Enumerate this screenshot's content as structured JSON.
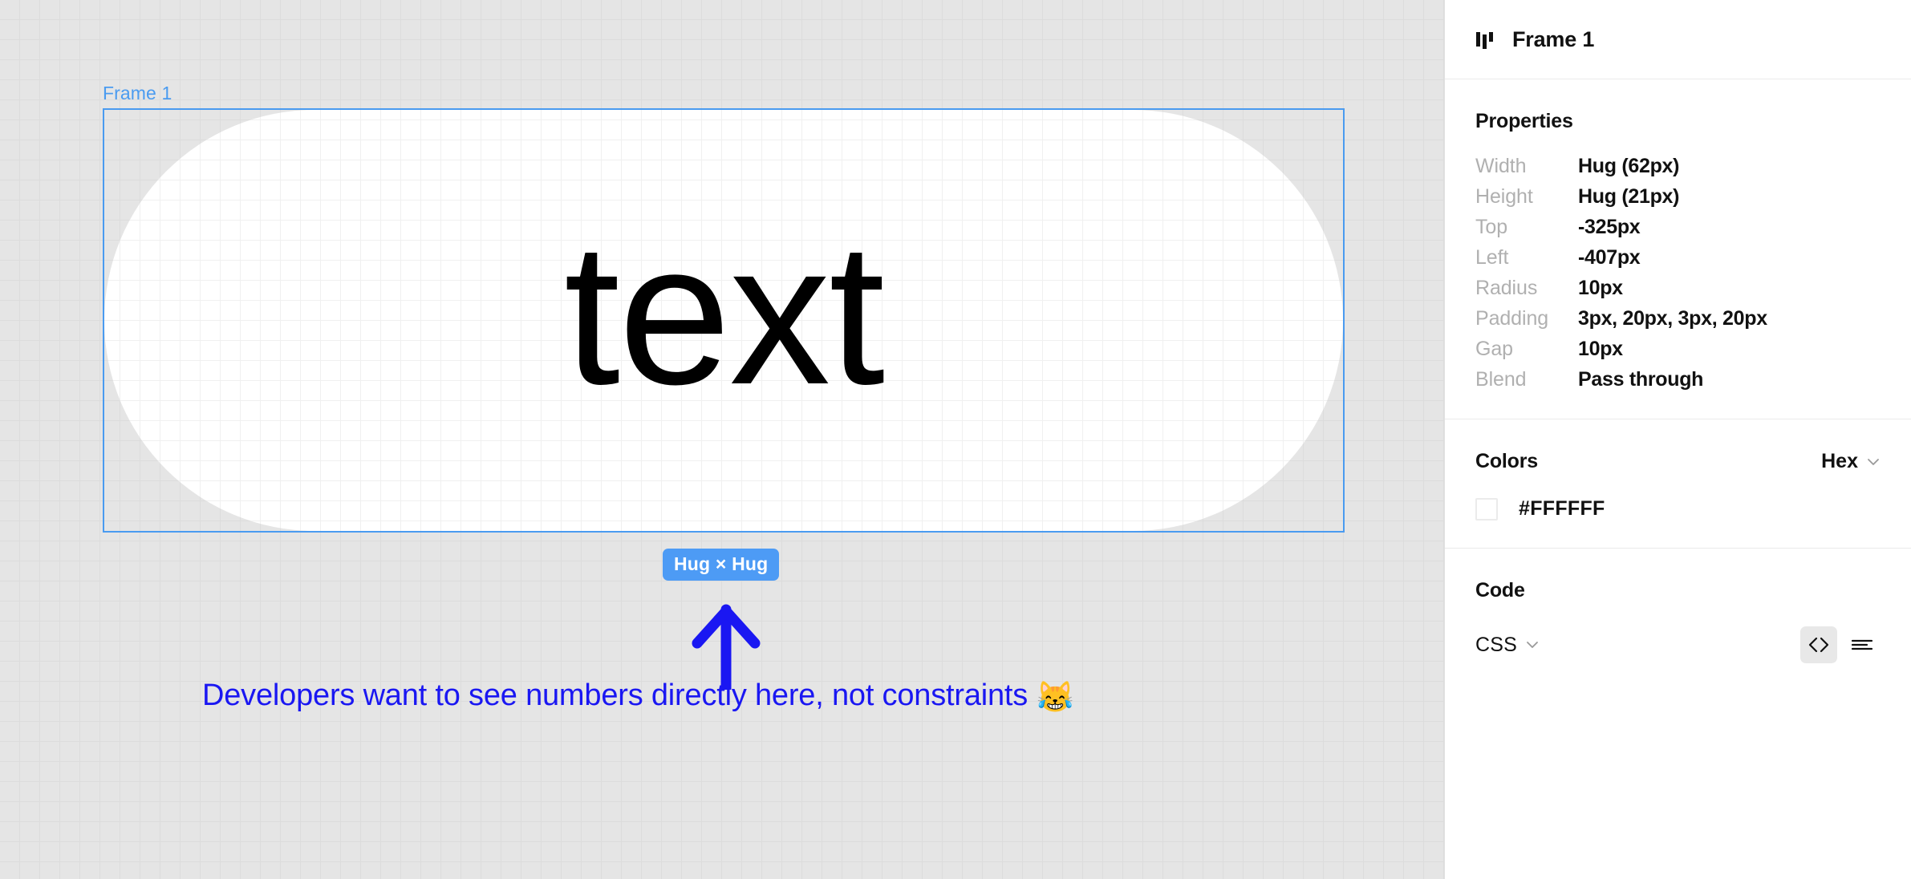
{
  "canvas": {
    "frame_label": "Frame 1",
    "element_text": "text",
    "badge_label": "Hug × Hug",
    "annotation_text": "Developers want to see numbers directly here, not constraints",
    "annotation_emoji": "😹",
    "arrow_color": "#1a17f2",
    "frame_outline_color": "#4a9bf0",
    "badge_color": "#4d9bf5",
    "element_fill": "#FFFFFF"
  },
  "sidebar": {
    "header": {
      "icon": "autolayout-icon",
      "title": "Frame 1"
    },
    "properties": {
      "title": "Properties",
      "rows": [
        {
          "key": "Width",
          "value": "Hug (62px)"
        },
        {
          "key": "Height",
          "value": "Hug (21px)"
        },
        {
          "key": "Top",
          "value": "-325px"
        },
        {
          "key": "Left",
          "value": "-407px"
        },
        {
          "key": "Radius",
          "value": "10px"
        },
        {
          "key": "Padding",
          "value": "3px, 20px, 3px, 20px"
        },
        {
          "key": "Gap",
          "value": "10px"
        },
        {
          "key": "Blend",
          "value": "Pass through"
        }
      ]
    },
    "colors": {
      "title": "Colors",
      "format": "Hex",
      "swatches": [
        {
          "hex": "#FFFFFF",
          "value": "#FFFFFF"
        }
      ]
    },
    "code": {
      "title": "Code",
      "language": "CSS",
      "actions": [
        {
          "icon": "code-brackets-icon",
          "active": true
        },
        {
          "icon": "text-lines-icon",
          "active": false
        }
      ]
    }
  }
}
